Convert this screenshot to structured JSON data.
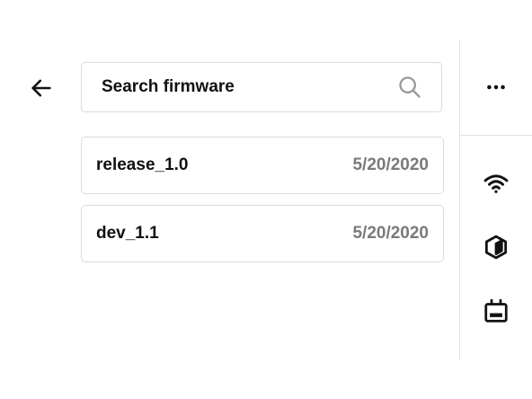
{
  "search": {
    "placeholder": "Search firmware",
    "value": ""
  },
  "firmware": [
    {
      "name": "release_1.0",
      "date": "5/20/2020"
    },
    {
      "name": "dev_1.1",
      "date": "5/20/2020"
    }
  ],
  "icons": {
    "back": "arrow-left-icon",
    "search": "search-icon",
    "more": "more-horizontal-icon",
    "wifi": "wifi-icon",
    "cube": "cube-icon",
    "board": "board-icon"
  },
  "colors": {
    "text": "#111111",
    "muted": "#7a7a7a",
    "border": "#dcdcdc",
    "search_icon": "#9a9a9a"
  }
}
